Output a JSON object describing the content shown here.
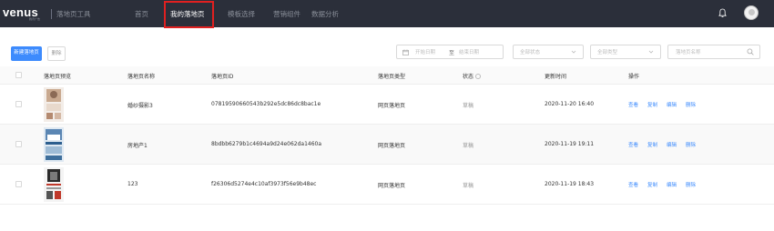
{
  "header": {
    "logo": "venus",
    "logo_sub": "腾讯广告",
    "product_name": "落地页工具",
    "nav": [
      {
        "label": "首页",
        "active": false
      },
      {
        "label": "我的落地页",
        "active": true
      },
      {
        "label": "模板选择",
        "active": false
      },
      {
        "label": "营销组件",
        "active": false
      },
      {
        "label": "数据分析",
        "active": false
      }
    ]
  },
  "toolbar": {
    "new_button": "新建落地页",
    "delete_button": "删除",
    "date_start_placeholder": "开始日期",
    "date_separator": "至",
    "date_end_placeholder": "结束日期",
    "status_placeholder": "全部状态",
    "type_placeholder": "全部类型",
    "search_placeholder": "落地页名称"
  },
  "table": {
    "columns": [
      "落地页预览",
      "落地页名称",
      "落地页ID",
      "落地页类型",
      "状态",
      "更新时间",
      "操作"
    ],
    "rows": [
      {
        "name": "婚纱摄影3",
        "id": "07819590660543b292e5dc86dc8bac1e",
        "type": "网页落地页",
        "status": "草稿",
        "updated": "2020-11-20 16:40"
      },
      {
        "name": "房地产1",
        "id": "8bdbb6279b1c4694a9d24e062da1460a",
        "type": "网页落地页",
        "status": "草稿",
        "updated": "2020-11-19 19:11"
      },
      {
        "name": "123",
        "id": "f26306d5274e4c10af3973f56e9b48ec",
        "type": "网页落地页",
        "status": "草稿",
        "updated": "2020-11-19 18:43"
      }
    ],
    "actions": [
      "查看",
      "复制",
      "编辑",
      "删除"
    ]
  },
  "colors": {
    "navbar_bg": "#2b2f3a",
    "primary": "#3d8bfd",
    "highlight_box": "#e02020"
  }
}
